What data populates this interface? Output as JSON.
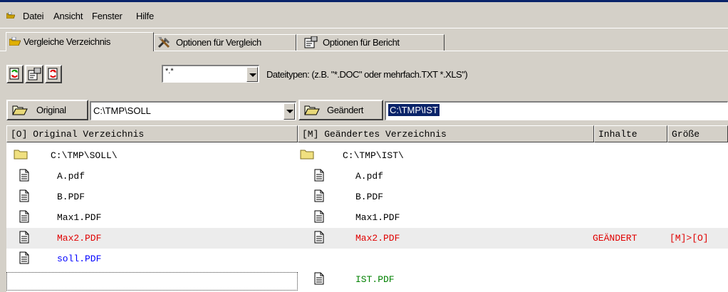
{
  "menu": [
    "Datei",
    "Ansicht",
    "Fenster",
    "Hilfe"
  ],
  "tabs": [
    "Vergleiche Verzeichnis",
    "Optionen für Vergleich",
    "Optionen für Bericht"
  ],
  "toolbar": {
    "filetype_value": "*.*",
    "filetype_hint": "Dateitypen: (z.B. \"*.DOC\" oder mehrfach.TXT *.XLS\")"
  },
  "paths": {
    "original_label": "Original",
    "original_value": "C:\\TMP\\SOLL",
    "changed_label": "Geändert",
    "changed_value": "C:\\TMP\\IST"
  },
  "grid": {
    "columns": [
      "[O] Original Verzeichnis",
      "[M] Geändertes Verzeichnis",
      "Inhalte",
      "Größe"
    ],
    "rows": [
      {
        "type": "folder",
        "left": "C:\\TMP\\SOLL\\",
        "right": "C:\\TMP\\IST\\",
        "content": "",
        "size": "",
        "left_color": "#000000",
        "right_color": "#000000"
      },
      {
        "type": "file",
        "left": "A.pdf",
        "right": "A.pdf",
        "content": "",
        "size": "",
        "left_color": "#000000",
        "right_color": "#000000"
      },
      {
        "type": "file",
        "left": "B.PDF",
        "right": "B.PDF",
        "content": "",
        "size": "",
        "left_color": "#000000",
        "right_color": "#000000"
      },
      {
        "type": "file",
        "left": "Max1.PDF",
        "right": "Max1.PDF",
        "content": "",
        "size": "",
        "left_color": "#000000",
        "right_color": "#000000"
      },
      {
        "type": "file",
        "left": "Max2.PDF",
        "right": "Max2.PDF",
        "content": "GEÄNDERT",
        "size": "[M]>[O]",
        "left_color": "#e00000",
        "right_color": "#e00000"
      },
      {
        "type": "file",
        "left": "soll.PDF",
        "right": "",
        "content": "",
        "size": "",
        "left_color": "#0000ff",
        "right_color": "#000000"
      },
      {
        "type": "file",
        "left": "",
        "right": "IST.PDF",
        "content": "",
        "size": "",
        "left_color": "#000000",
        "right_color": "#008000"
      }
    ]
  },
  "colors": {
    "changed": "#e00000",
    "only_original": "#0000ff",
    "only_changed": "#008000",
    "selection": "#0a246a"
  }
}
